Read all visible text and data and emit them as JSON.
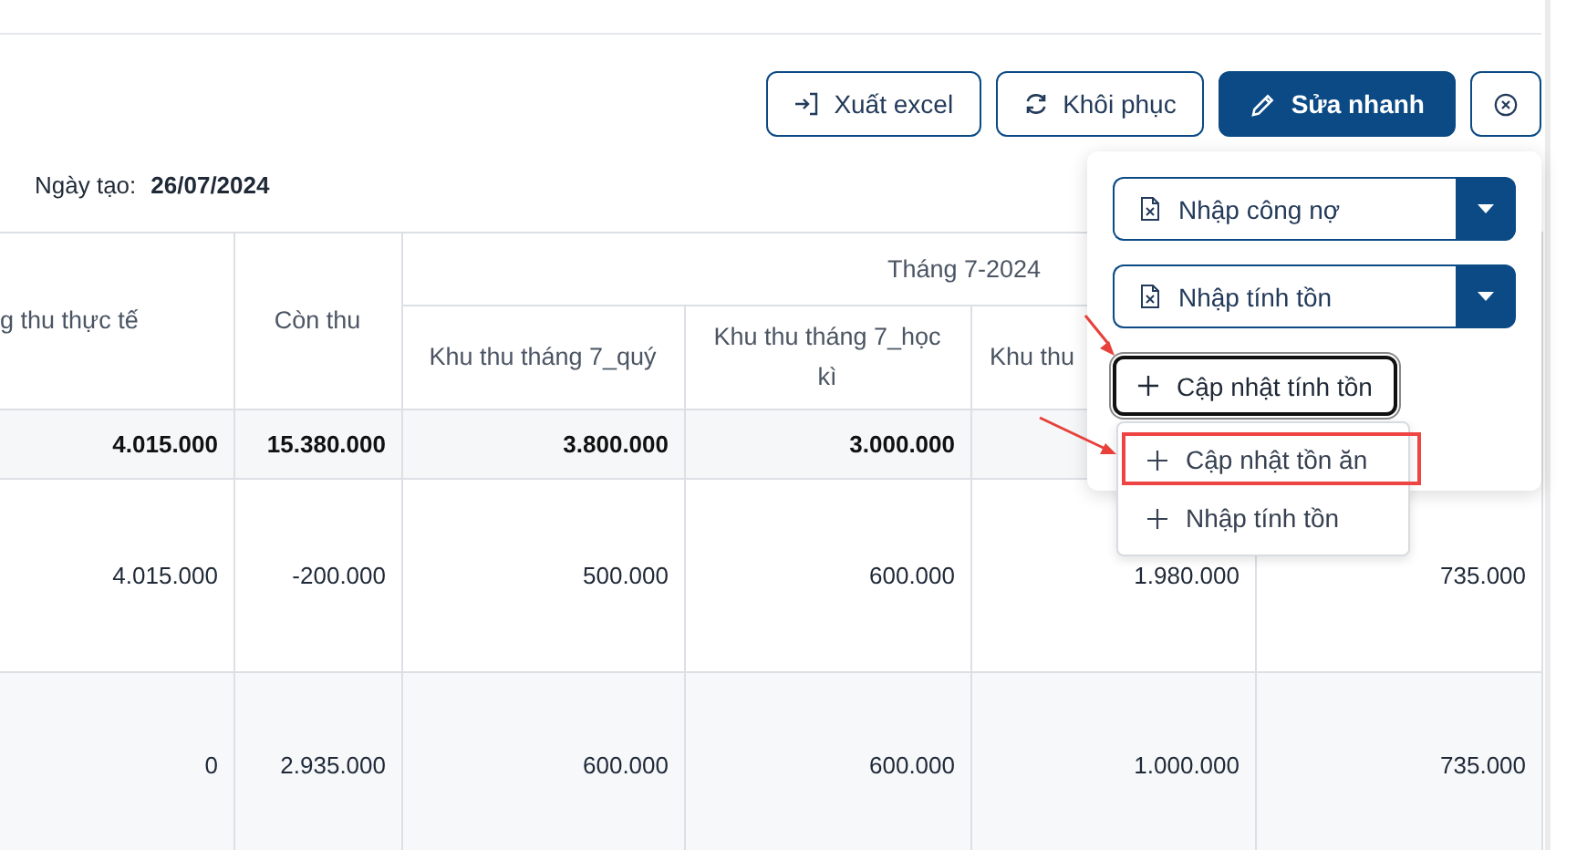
{
  "toolbar": {
    "buttons": [
      {
        "kind": "export",
        "label": "Xuất excel"
      },
      {
        "kind": "restore",
        "label": "Khôi phục"
      },
      {
        "kind": "edit",
        "label": "Sửa nhanh"
      },
      {
        "kind": "close"
      }
    ]
  },
  "created": {
    "label": "Ngày tạo:",
    "value": "26/07/2024"
  },
  "table": {
    "columns": [
      "g thu thực tế",
      "Còn thu"
    ],
    "group": "Tháng 7-2024",
    "sub_columns": [
      "Khu thu tháng 7_quý",
      "Khu thu tháng 7_học kì",
      "Khu thu"
    ],
    "summary": [
      "4.015.000",
      "15.380.000",
      "3.800.000",
      "3.000.000"
    ],
    "rows": [
      [
        "4.015.000",
        "-200.000",
        "500.000",
        "600.000",
        "1.980.000",
        "735.000"
      ],
      [
        "0",
        "2.935.000",
        "600.000",
        "600.000",
        "1.000.000",
        "735.000"
      ]
    ]
  },
  "popup": {
    "split_buttons": [
      "Nhập công nợ",
      "Nhập tính tồn"
    ],
    "action": {
      "label": "Cập nhật tính tồn",
      "focused": true
    },
    "menu": [
      {
        "label": "Cập nhật tồn ăn",
        "highlighted": true
      },
      {
        "label": "Nhập tính tồn",
        "highlighted": false
      }
    ]
  }
}
